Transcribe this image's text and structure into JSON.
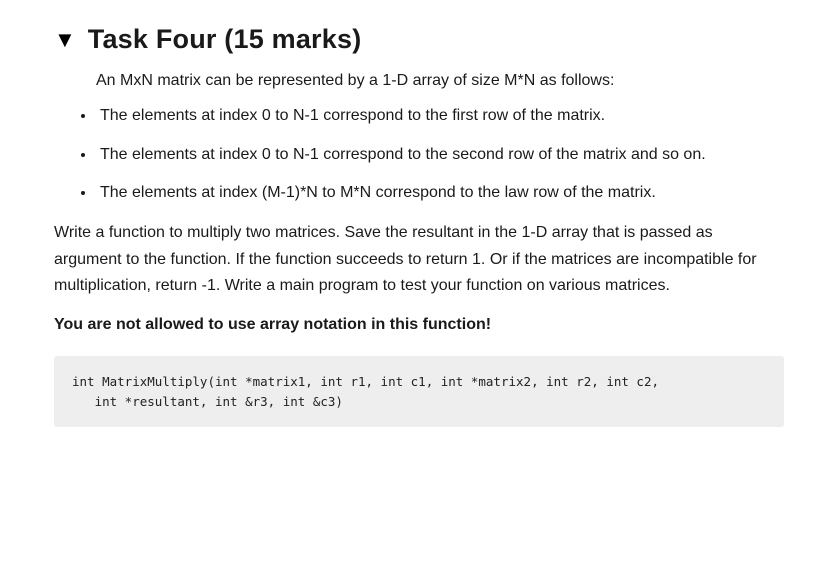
{
  "heading": {
    "disclosure_glyph": "▼",
    "title": "Task  Four (15 marks)"
  },
  "intro": "An MxN matrix can be represented by a 1-D array of size M*N as follows:",
  "bullets": [
    "The elements at index 0 to N-1 correspond to the first row of the matrix.",
    "The elements at index 0 to N-1 correspond to the second row of the matrix and so on.",
    "The elements at index (M-1)*N to M*N correspond to the law row of the matrix."
  ],
  "body": "Write a function to multiply two matrices. Save the resultant in the 1-D array that is passed as argument to the function. If the function succeeds to return 1. Or if the matrices are incompatible for multiplication, return -1. Write a main program to test your function on various matrices.",
  "warning": "You are not allowed to use array notation in this function!",
  "code": "int MatrixMultiply(int *matrix1, int r1, int c1, int *matrix2, int r2, int c2,\n   int *resultant, int &r3, int &c3)"
}
